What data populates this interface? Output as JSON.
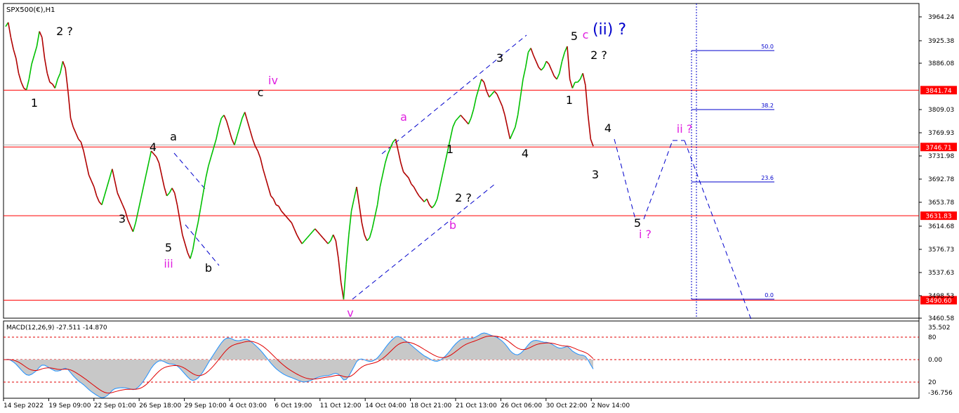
{
  "chart_data": {
    "type": "line",
    "title": "SPX500(€),H1",
    "symbol_timeframe": "SPX500(€),H1",
    "price_axis": {
      "ticks": [
        "3964.24",
        "3925.38",
        "3886.08",
        "3809.03",
        "3769.93",
        "3731.98",
        "3692.78",
        "3653.78",
        "3614.68",
        "3576.73",
        "3537.63",
        "3498.53",
        "3460.58"
      ],
      "ylim": [
        3460.58,
        3964.24
      ]
    },
    "time_axis": {
      "ticks": [
        "14 Sep 2022",
        "19 Sep 09:00",
        "22 Sep 01:00",
        "26 Sep 18:00",
        "29 Sep 10:00",
        "4 Oct 03:00",
        "6 Oct 19:00",
        "11 Oct 12:00",
        "14 Oct 04:00",
        "18 Oct 21:00",
        "21 Oct 13:00",
        "26 Oct 06:00",
        "30 Oct 22:00",
        "2 Nov 14:00"
      ]
    },
    "horizontal_levels": [
      {
        "value": 3841.74,
        "label": "3841.74",
        "color": "#ff0000"
      },
      {
        "value": 3746.71,
        "label": "3746.71",
        "color": "#ff0000"
      },
      {
        "value": 3631.83,
        "label": "3631.83",
        "color": "#ff0000"
      },
      {
        "value": 3490.6,
        "label": "3490.60",
        "color": "#ff0000"
      }
    ],
    "fib_levels": [
      {
        "label": "50.0"
      },
      {
        "label": "38.2"
      },
      {
        "label": "23.6"
      },
      {
        "label": "0.0"
      }
    ],
    "price_path": [
      3948,
      3955,
      3930,
      3910,
      3895,
      3870,
      3855,
      3845,
      3842,
      3860,
      3885,
      3900,
      3915,
      3940,
      3930,
      3895,
      3870,
      3855,
      3852,
      3845,
      3860,
      3870,
      3890,
      3878,
      3840,
      3795,
      3780,
      3770,
      3760,
      3755,
      3740,
      3720,
      3700,
      3690,
      3680,
      3665,
      3655,
      3650,
      3665,
      3680,
      3695,
      3710,
      3690,
      3670,
      3660,
      3650,
      3640,
      3625,
      3615,
      3605,
      3620,
      3640,
      3660,
      3680,
      3700,
      3720,
      3740,
      3735,
      3730,
      3720,
      3700,
      3680,
      3665,
      3670,
      3678,
      3670,
      3650,
      3625,
      3600,
      3585,
      3570,
      3560,
      3575,
      3600,
      3620,
      3645,
      3670,
      3695,
      3715,
      3730,
      3745,
      3760,
      3780,
      3795,
      3800,
      3790,
      3775,
      3760,
      3750,
      3765,
      3780,
      3795,
      3805,
      3790,
      3775,
      3760,
      3748,
      3740,
      3728,
      3710,
      3695,
      3680,
      3665,
      3660,
      3650,
      3648,
      3640,
      3635,
      3630,
      3625,
      3620,
      3610,
      3600,
      3592,
      3585,
      3590,
      3595,
      3600,
      3605,
      3610,
      3605,
      3600,
      3595,
      3590,
      3585,
      3590,
      3600,
      3590,
      3560,
      3520,
      3492,
      3550,
      3600,
      3640,
      3660,
      3680,
      3650,
      3620,
      3600,
      3590,
      3595,
      3610,
      3630,
      3650,
      3680,
      3700,
      3720,
      3735,
      3745,
      3755,
      3760,
      3740,
      3720,
      3705,
      3700,
      3695,
      3685,
      3680,
      3672,
      3665,
      3660,
      3655,
      3660,
      3650,
      3645,
      3650,
      3660,
      3680,
      3700,
      3720,
      3740,
      3760,
      3780,
      3790,
      3795,
      3800,
      3795,
      3790,
      3785,
      3795,
      3810,
      3830,
      3845,
      3860,
      3855,
      3840,
      3830,
      3835,
      3840,
      3835,
      3825,
      3815,
      3800,
      3780,
      3760,
      3770,
      3780,
      3800,
      3830,
      3860,
      3880,
      3905,
      3912,
      3900,
      3890,
      3880,
      3875,
      3880,
      3890,
      3885,
      3875,
      3865,
      3860,
      3870,
      3890,
      3905,
      3915,
      3860,
      3845,
      3855,
      3855,
      3860,
      3870,
      3850,
      3800,
      3760,
      3748
    ],
    "macd": {
      "label": "MACD(12,26,9) -27.511 -14.870",
      "ticks": [
        "35.502",
        "80",
        "0.00",
        "20",
        "-36.756"
      ]
    },
    "wave_labels": {
      "black": [
        "1",
        "2 ?",
        "3",
        "4",
        "5",
        "a",
        "b",
        "c",
        "1",
        "2 ?",
        "3",
        "4",
        "5",
        "1",
        "2 ?",
        "3",
        "4",
        "5"
      ],
      "magenta": [
        "iii",
        "iv",
        "v",
        "a",
        "b",
        "c",
        "ii ?",
        "i ?"
      ],
      "blue": [
        "(ii) ?"
      ]
    }
  }
}
